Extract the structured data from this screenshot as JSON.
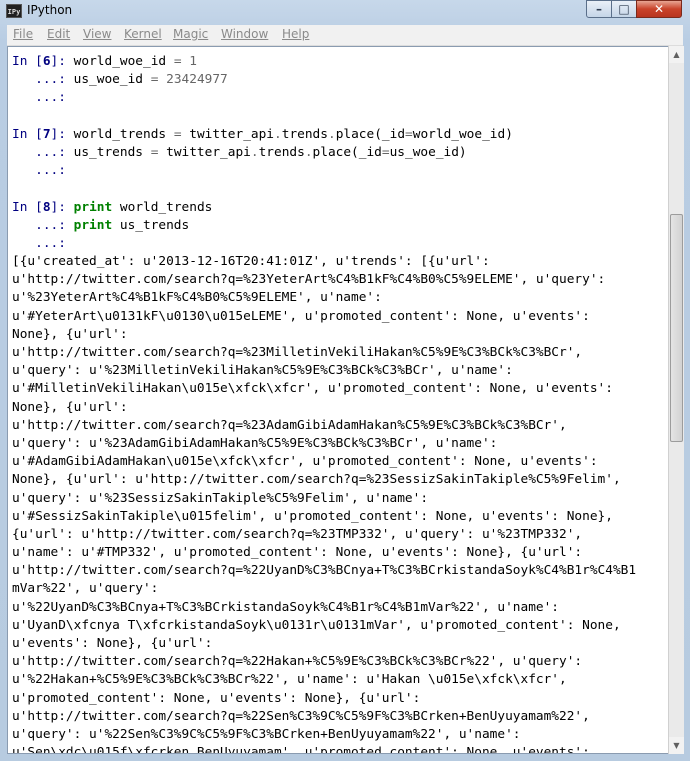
{
  "window": {
    "title": "IPython",
    "app_icon_text": "IPy"
  },
  "menu": [
    "File",
    "Edit",
    "View",
    "Kernel",
    "Magic",
    "Window",
    "Help"
  ],
  "cells": [
    {
      "n": "6",
      "lines": [
        [
          [
            "t",
            "world_woe_id "
          ],
          [
            "o",
            "="
          ],
          [
            "t",
            " "
          ],
          [
            "l",
            "1"
          ]
        ],
        [
          [
            "t",
            "us_woe_id "
          ],
          [
            "o",
            "="
          ],
          [
            "t",
            " "
          ],
          [
            "l",
            "23424977"
          ]
        ],
        []
      ]
    },
    {
      "n": "7",
      "lines": [
        [
          [
            "t",
            "world_trends "
          ],
          [
            "o",
            "="
          ],
          [
            "t",
            " twitter_api"
          ],
          [
            "o",
            "."
          ],
          [
            "t",
            "trends"
          ],
          [
            "o",
            "."
          ],
          [
            "t",
            "place(_id"
          ],
          [
            "o",
            "="
          ],
          [
            "t",
            "world_woe_id)"
          ]
        ],
        [
          [
            "t",
            "us_trends "
          ],
          [
            "o",
            "="
          ],
          [
            "t",
            " twitter_api"
          ],
          [
            "o",
            "."
          ],
          [
            "t",
            "trends"
          ],
          [
            "o",
            "."
          ],
          [
            "t",
            "place(_id"
          ],
          [
            "o",
            "="
          ],
          [
            "t",
            "us_woe_id)"
          ]
        ],
        []
      ]
    },
    {
      "n": "8",
      "lines": [
        [
          [
            "k",
            "print"
          ],
          [
            "t",
            " world_trends"
          ]
        ],
        [
          [
            "k",
            "print"
          ],
          [
            "t",
            " us_trends"
          ]
        ],
        []
      ]
    }
  ],
  "output": [
    "[{u'created_at': u'2013-12-16T20:41:01Z', u'trends': [{u'url':",
    "u'http://twitter.com/search?q=%23YeterArt%C4%B1kF%C4%B0%C5%9ELEME', u'query':",
    "u'%23YeterArt%C4%B1kF%C4%B0%C5%9ELEME', u'name':",
    "u'#YeterArt\\u0131kF\\u0130\\u015eLEME', u'promoted_content': None, u'events':",
    "None}, {u'url':",
    "u'http://twitter.com/search?q=%23MilletinVekiliHakan%C5%9E%C3%BCk%C3%BCr',",
    "u'query': u'%23MilletinVekiliHakan%C5%9E%C3%BCk%C3%BCr', u'name':",
    "u'#MilletinVekiliHakan\\u015e\\xfck\\xfcr', u'promoted_content': None, u'events':",
    "None}, {u'url':",
    "u'http://twitter.com/search?q=%23AdamGibiAdamHakan%C5%9E%C3%BCk%C3%BCr',",
    "u'query': u'%23AdamGibiAdamHakan%C5%9E%C3%BCk%C3%BCr', u'name':",
    "u'#AdamGibiAdamHakan\\u015e\\xfck\\xfcr', u'promoted_content': None, u'events':",
    "None}, {u'url': u'http://twitter.com/search?q=%23SessizSakinTakiple%C5%9Felim',",
    "u'query': u'%23SessizSakinTakiple%C5%9Felim', u'name':",
    "u'#SessizSakinTakiple\\u015felim', u'promoted_content': None, u'events': None},",
    "{u'url': u'http://twitter.com/search?q=%23TMP332', u'query': u'%23TMP332',",
    "u'name': u'#TMP332', u'promoted_content': None, u'events': None}, {u'url':",
    "u'http://twitter.com/search?q=%22UyanD%C3%BCnya+T%C3%BCrkistandaSoyk%C4%B1r%C4%B1",
    "mVar%22', u'query':",
    "u'%22UyanD%C3%BCnya+T%C3%BCrkistandaSoyk%C4%B1r%C4%B1mVar%22', u'name':",
    "u'UyanD\\xfcnya T\\xfcrkistandaSoyk\\u0131r\\u0131mVar', u'promoted_content': None,",
    "u'events': None}, {u'url':",
    "u'http://twitter.com/search?q=%22Hakan+%C5%9E%C3%BCk%C3%BCr%22', u'query':",
    "u'%22Hakan+%C5%9E%C3%BCk%C3%BCr%22', u'name': u'Hakan \\u015e\\xfck\\xfcr',",
    "u'promoted_content': None, u'events': None}, {u'url':",
    "u'http://twitter.com/search?q=%22Sen%C3%9C%C5%9F%C3%BCrken+BenUyuyamam%22',",
    "u'query': u'%22Sen%C3%9C%C5%9F%C3%BCrken+BenUyuyamam%22', u'name':",
    "u'Sen\\xdc\\u015f\\xfcrken BenUyuyamam', u'promoted_content': None, u'events':"
  ],
  "prompt": {
    "in": "In ",
    "cont": "   ...: ",
    "cont_empty": "   ...:"
  },
  "scroll_position": 0.3
}
